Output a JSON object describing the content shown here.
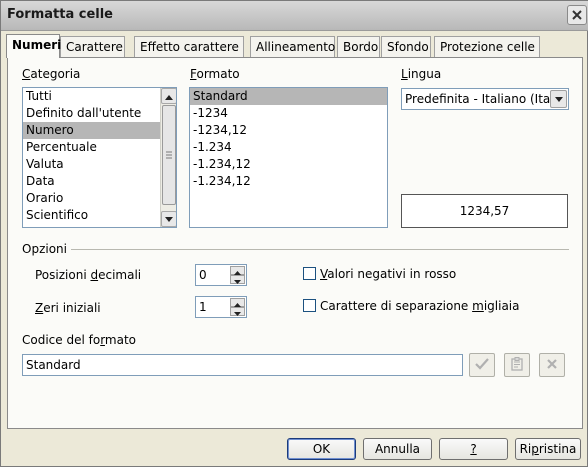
{
  "window": {
    "title": "Formatta celle"
  },
  "tabs": [
    {
      "label": "Numeri",
      "active": true
    },
    {
      "label": "Carattere"
    },
    {
      "label": "Effetto carattere"
    },
    {
      "label": "Allineamento"
    },
    {
      "label": "Bordo"
    },
    {
      "label": "Sfondo"
    },
    {
      "label": "Protezione celle"
    }
  ],
  "category": {
    "label_first": "C",
    "label_rest": "ategoria",
    "items": [
      "Tutti",
      "Definito dall'utente",
      "Numero",
      "Percentuale",
      "Valuta",
      "Data",
      "Orario",
      "Scientifico"
    ],
    "selected": "Numero"
  },
  "format": {
    "label_first": "F",
    "label_rest": "ormato",
    "items": [
      "Standard",
      "-1234",
      "-1234,12",
      "-1.234",
      "-1.234,12",
      "-1.234,12"
    ],
    "selected": "Standard"
  },
  "language": {
    "label_first": "L",
    "label_rest": "ingua",
    "value": "Predefinita - Italiano (Itali"
  },
  "preview": {
    "value": "1234,57"
  },
  "options": {
    "title": "Opzioni",
    "decimals": {
      "label_a": "Posizioni ",
      "label_u": "d",
      "label_b": "ecimali",
      "value": "0"
    },
    "leading_zeros": {
      "label_u": "Z",
      "label_b": "eri iniziali",
      "value": "1"
    },
    "negative_red": {
      "label_u": "V",
      "label_b": "alori negativi in rosso",
      "checked": false
    },
    "thousands_sep": {
      "label_a": "Carattere di separazione ",
      "label_u": "m",
      "label_b": "igliaia",
      "checked": false
    }
  },
  "format_code": {
    "label_a": "Codice del fo",
    "label_u": "r",
    "label_b": "mato",
    "value": "Standard"
  },
  "buttons": {
    "ok": "OK",
    "cancel": "Annulla",
    "help_u": "?",
    "reset_a": "Ri",
    "reset_u": "p",
    "reset_b": "ristina"
  },
  "icons": {
    "close": "close-icon",
    "scroll_up": "chevron-up-icon",
    "scroll_down": "chevron-down-icon",
    "accept": "checkmark-icon",
    "edit_comment": "comment-icon",
    "delete": "delete-icon"
  }
}
